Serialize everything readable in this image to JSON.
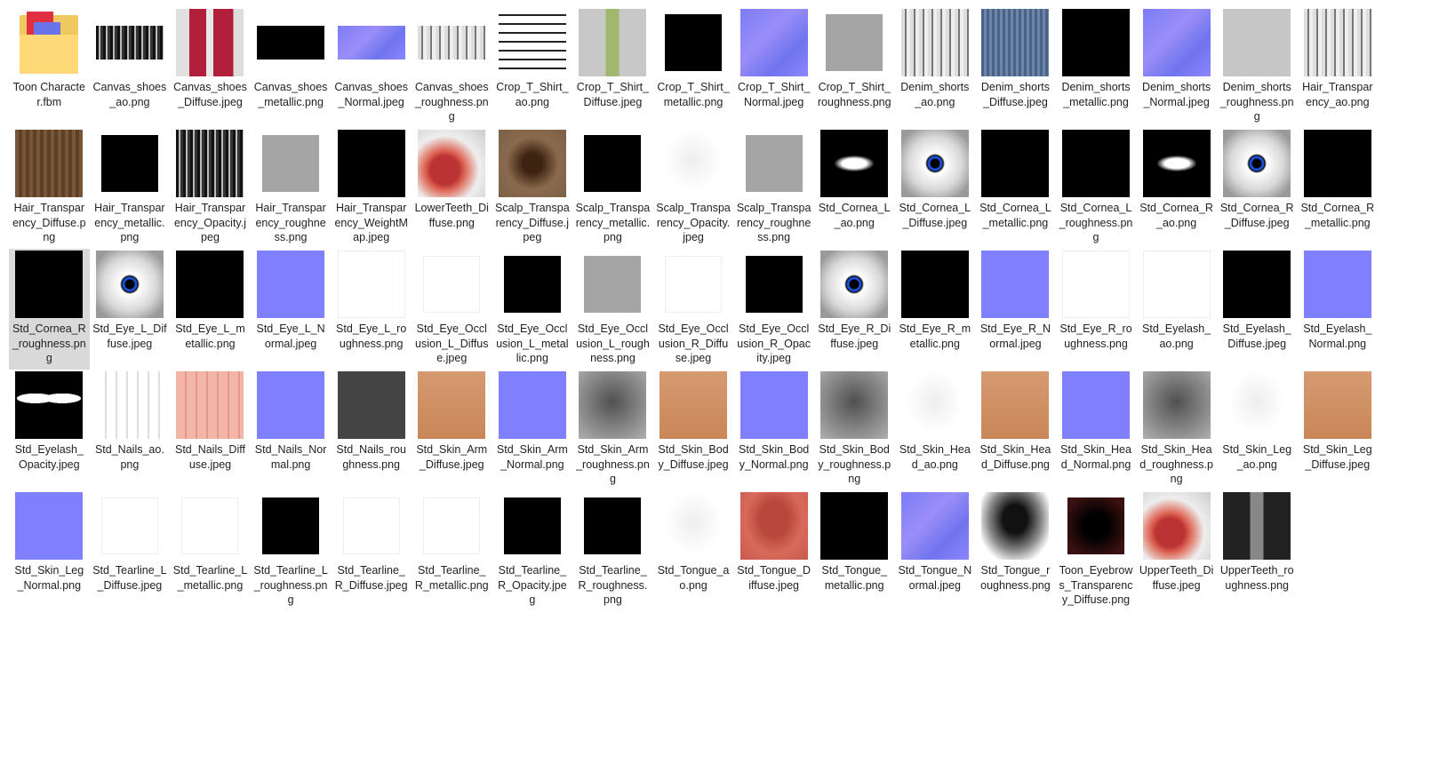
{
  "view": {
    "selected_index": 34,
    "items": [
      {
        "label": "Toon Character.fbm",
        "look": "folder"
      },
      {
        "label": "Canvas_shoes_ao.png",
        "look": "hair",
        "shape": "wide"
      },
      {
        "label": "Canvas_shoes_Diffuse.jpeg",
        "look": "red"
      },
      {
        "label": "Canvas_shoes_metallic.png",
        "look": "black",
        "shape": "wide"
      },
      {
        "label": "Canvas_shoes_Normal.jpeg",
        "look": "normal-tex",
        "shape": "wide"
      },
      {
        "label": "Canvas_shoes_roughness.png",
        "look": "hair-light",
        "shape": "wide"
      },
      {
        "label": "Crop_T_Shirt_ao.png",
        "look": "shirt"
      },
      {
        "label": "Crop_T_Shirt_Diffuse.jpeg",
        "look": "green"
      },
      {
        "label": "Crop_T_Shirt_metallic.png",
        "look": "black",
        "shape": "mid"
      },
      {
        "label": "Crop_T_Shirt_Normal.jpeg",
        "look": "normal-tex"
      },
      {
        "label": "Crop_T_Shirt_roughness.png",
        "look": "gray",
        "shape": "mid"
      },
      {
        "label": "Denim_shorts_ao.png",
        "look": "hair-light"
      },
      {
        "label": "Denim_shorts_Diffuse.jpeg",
        "look": "denim"
      },
      {
        "label": "Denim_shorts_metallic.png",
        "look": "black"
      },
      {
        "label": "Denim_shorts_Normal.jpeg",
        "look": "normal-tex"
      },
      {
        "label": "Denim_shorts_roughness.png",
        "look": "gray-light"
      },
      {
        "label": "Hair_Transparency_ao.png",
        "look": "hair-light"
      },
      {
        "label": "Hair_Transparency_Diffuse.png",
        "look": "wood"
      },
      {
        "label": "Hair_Transparency_metallic.png",
        "look": "black",
        "shape": "mid"
      },
      {
        "label": "Hair_Transparency_Opacity.jpeg",
        "look": "hair"
      },
      {
        "label": "Hair_Transparency_roughness.png",
        "look": "gray",
        "shape": "mid"
      },
      {
        "label": "Hair_Transparency_WeightMap.jpeg",
        "look": "black"
      },
      {
        "label": "LowerTeeth_Diffuse.png",
        "look": "teeth"
      },
      {
        "label": "Scalp_Transparency_Diffuse.jpeg",
        "look": "scalp"
      },
      {
        "label": "Scalp_Transparency_metallic.png",
        "look": "black",
        "shape": "mid"
      },
      {
        "label": "Scalp_Transparency_Opacity.jpeg",
        "look": "white-face"
      },
      {
        "label": "Scalp_Transparency_roughness.png",
        "look": "gray",
        "shape": "mid"
      },
      {
        "label": "Std_Cornea_L_ao.png",
        "look": "blob"
      },
      {
        "label": "Std_Cornea_L_Diffuse.jpeg",
        "look": "eye"
      },
      {
        "label": "Std_Cornea_L_metallic.png",
        "look": "black"
      },
      {
        "label": "Std_Cornea_L_roughness.png",
        "look": "black"
      },
      {
        "label": "Std_Cornea_R_ao.png",
        "look": "blob"
      },
      {
        "label": "Std_Cornea_R_Diffuse.jpeg",
        "look": "eye"
      },
      {
        "label": "Std_Cornea_R_metallic.png",
        "look": "black"
      },
      {
        "label": "Std_Cornea_R_roughness.png",
        "look": "black"
      },
      {
        "label": "Std_Eye_L_Diffuse.jpeg",
        "look": "eye"
      },
      {
        "label": "Std_Eye_L_metallic.png",
        "look": "black"
      },
      {
        "label": "Std_Eye_L_Normal.jpeg",
        "look": "normal"
      },
      {
        "label": "Std_Eye_L_roughness.png",
        "look": "white"
      },
      {
        "label": "Std_Eye_Occlusion_L_Diffuse.jpeg",
        "look": "white",
        "shape": "mid"
      },
      {
        "label": "Std_Eye_Occlusion_L_metallic.png",
        "look": "black",
        "shape": "mid"
      },
      {
        "label": "Std_Eye_Occlusion_L_roughness.png",
        "look": "gray",
        "shape": "mid"
      },
      {
        "label": "Std_Eye_Occlusion_R_Diffuse.jpeg",
        "look": "white",
        "shape": "mid"
      },
      {
        "label": "Std_Eye_Occlusion_R_Opacity.jpeg",
        "look": "black",
        "shape": "mid"
      },
      {
        "label": "Std_Eye_R_Diffuse.jpeg",
        "look": "eye"
      },
      {
        "label": "Std_Eye_R_metallic.png",
        "look": "black"
      },
      {
        "label": "Std_Eye_R_Normal.jpeg",
        "look": "normal"
      },
      {
        "label": "Std_Eye_R_roughness.png",
        "look": "white"
      },
      {
        "label": "Std_Eyelash_ao.png",
        "look": "white"
      },
      {
        "label": "Std_Eyelash_Diffuse.jpeg",
        "look": "black"
      },
      {
        "label": "Std_Eyelash_Normal.png",
        "look": "normal"
      },
      {
        "label": "Std_Eyelash_Opacity.jpeg",
        "look": "eyelash-op"
      },
      {
        "label": "Std_Nails_ao.png",
        "look": "nails"
      },
      {
        "label": "Std_Nails_Diffuse.jpeg",
        "look": "nails-pink"
      },
      {
        "label": "Std_Nails_Normal.png",
        "look": "normal"
      },
      {
        "label": "Std_Nails_roughness.png",
        "look": "darkgray"
      },
      {
        "label": "Std_Skin_Arm_Diffuse.jpeg",
        "look": "skin"
      },
      {
        "label": "Std_Skin_Arm_Normal.png",
        "look": "normal"
      },
      {
        "label": "Std_Skin_Arm_roughness.png",
        "look": "skin-rough"
      },
      {
        "label": "Std_Skin_Body_Diffuse.jpeg",
        "look": "skin"
      },
      {
        "label": "Std_Skin_Body_Normal.png",
        "look": "normal"
      },
      {
        "label": "Std_Skin_Body_roughness.png",
        "look": "skin-rough"
      },
      {
        "label": "Std_Skin_Head_ao.png",
        "look": "white-face"
      },
      {
        "label": "Std_Skin_Head_Diffuse.png",
        "look": "skin"
      },
      {
        "label": "Std_Skin_Head_Normal.png",
        "look": "normal"
      },
      {
        "label": "Std_Skin_Head_roughness.png",
        "look": "skin-rough"
      },
      {
        "label": "Std_Skin_Leg_ao.png",
        "look": "white-face"
      },
      {
        "label": "Std_Skin_Leg_Diffuse.jpeg",
        "look": "skin"
      },
      {
        "label": "Std_Skin_Leg_Normal.png",
        "look": "normal"
      },
      {
        "label": "Std_Tearline_L_Diffuse.jpeg",
        "look": "white",
        "shape": "mid"
      },
      {
        "label": "Std_Tearline_L_metallic.png",
        "look": "white",
        "shape": "mid"
      },
      {
        "label": "Std_Tearline_L_roughness.png",
        "look": "black",
        "shape": "mid"
      },
      {
        "label": "Std_Tearline_R_Diffuse.jpeg",
        "look": "white",
        "shape": "mid"
      },
      {
        "label": "Std_Tearline_R_metallic.png",
        "look": "white",
        "shape": "mid"
      },
      {
        "label": "Std_Tearline_R_Opacity.jpeg",
        "look": "black",
        "shape": "mid"
      },
      {
        "label": "Std_Tearline_R_roughness.png",
        "look": "black",
        "shape": "mid"
      },
      {
        "label": "Std_Tongue_ao.png",
        "look": "white-face"
      },
      {
        "label": "Std_Tongue_Diffuse.jpeg",
        "look": "tongue"
      },
      {
        "label": "Std_Tongue_metallic.png",
        "look": "black"
      },
      {
        "label": "Std_Tongue_Normal.jpeg",
        "look": "normal-tex"
      },
      {
        "label": "Std_Tongue_roughness.png",
        "look": "chest"
      },
      {
        "label": "Toon_Eyebrows_Transparency_Diffuse.png",
        "look": "vignette",
        "shape": "mid"
      },
      {
        "label": "UpperTeeth_Diffuse.jpeg",
        "look": "teeth"
      },
      {
        "label": "UpperTeeth_roughness.png",
        "look": "uteeth-r"
      }
    ]
  }
}
